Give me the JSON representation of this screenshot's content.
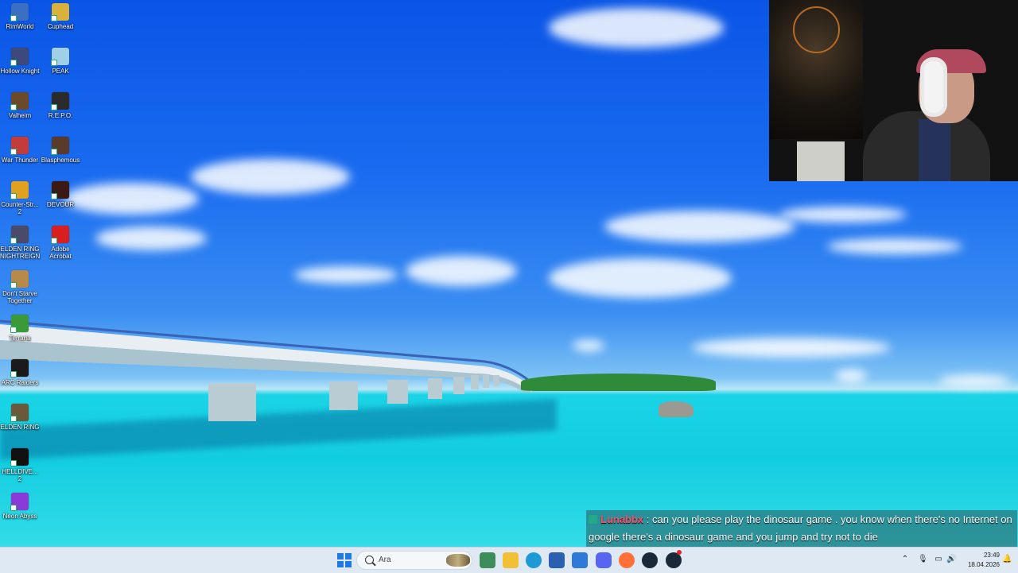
{
  "desktop": {
    "icons": [
      {
        "label": "RimWorld",
        "icon": "rimworld-icon",
        "color": "#3a6fc4"
      },
      {
        "label": "Cuphead",
        "icon": "cuphead-icon",
        "color": "#d8b23a"
      },
      {
        "label": "Hollow Knight",
        "icon": "hollow-knight-icon",
        "color": "#3b4a7a"
      },
      {
        "label": "PEAK",
        "icon": "peak-icon",
        "color": "#9fd0e8"
      },
      {
        "label": "Valheim",
        "icon": "valheim-icon",
        "color": "#6a4a2a"
      },
      {
        "label": "R.E.P.O.",
        "icon": "repo-icon",
        "color": "#2b2b2b"
      },
      {
        "label": "War Thunder",
        "icon": "war-thunder-icon",
        "color": "#c33b3b"
      },
      {
        "label": "Blasphemous",
        "icon": "blasphemous-icon",
        "color": "#5a3a2a"
      },
      {
        "label": "Counter-Str... 2",
        "icon": "counter-strike-icon",
        "color": "#e0a020"
      },
      {
        "label": "DEVOUR",
        "icon": "devour-icon",
        "color": "#3a1a12"
      },
      {
        "label": "ELDEN RING NIGHTREIGN",
        "icon": "elden-ring-nightreign-icon",
        "color": "#4a4a6a"
      },
      {
        "label": "Adobe Acrobat",
        "icon": "adobe-acrobat-icon",
        "color": "#d81e1e"
      },
      {
        "label": "Don't Starve Together",
        "icon": "dont-starve-icon",
        "color": "#b88a4a"
      },
      {
        "label": "Terraria",
        "icon": "terraria-icon",
        "color": "#3a9a3a"
      },
      {
        "label": "ARC Raiders",
        "icon": "arc-raiders-icon",
        "color": "#1a1a1a"
      },
      {
        "label": "ELDEN RING",
        "icon": "elden-ring-icon",
        "color": "#6a5a3a"
      },
      {
        "label": "HELLDIVE... 2",
        "icon": "helldivers-icon",
        "color": "#111111"
      },
      {
        "label": "Neon Abyss",
        "icon": "neon-abyss-icon",
        "color": "#8a3ad8"
      }
    ]
  },
  "chat": {
    "username": "Lunabbx",
    "separator": " : ",
    "message": "can you please play the dinosaur game . you know when there's no Internet on google there's a dinosaur game and you jump and try not to die"
  },
  "taskbar": {
    "search_placeholder": "Ara",
    "apps": [
      {
        "name": "widgets",
        "icon": "widgets-icon",
        "color": "#3c8d5a"
      },
      {
        "name": "file-explorer",
        "icon": "folder-icon",
        "color": "#f2c034"
      },
      {
        "name": "edge",
        "icon": "edge-icon",
        "color": "#1d9ad6"
      },
      {
        "name": "store",
        "icon": "store-icon",
        "color": "#2b5fb0"
      },
      {
        "name": "outlook",
        "icon": "outlook-icon",
        "color": "#2f7ad8"
      },
      {
        "name": "discord",
        "icon": "discord-icon",
        "color": "#5865f2"
      },
      {
        "name": "firefox",
        "icon": "firefox-icon",
        "color": "#ff7139"
      },
      {
        "name": "steam",
        "icon": "steam-icon",
        "color": "#1b2838"
      },
      {
        "name": "steam-2",
        "icon": "steam-icon",
        "color": "#1b2838"
      }
    ],
    "clock": {
      "time": "23:49",
      "date": "18.04.2026"
    }
  },
  "colors": {
    "taskbar_bg": "#dfe9f3",
    "chat_username": "#ff4d6a"
  }
}
